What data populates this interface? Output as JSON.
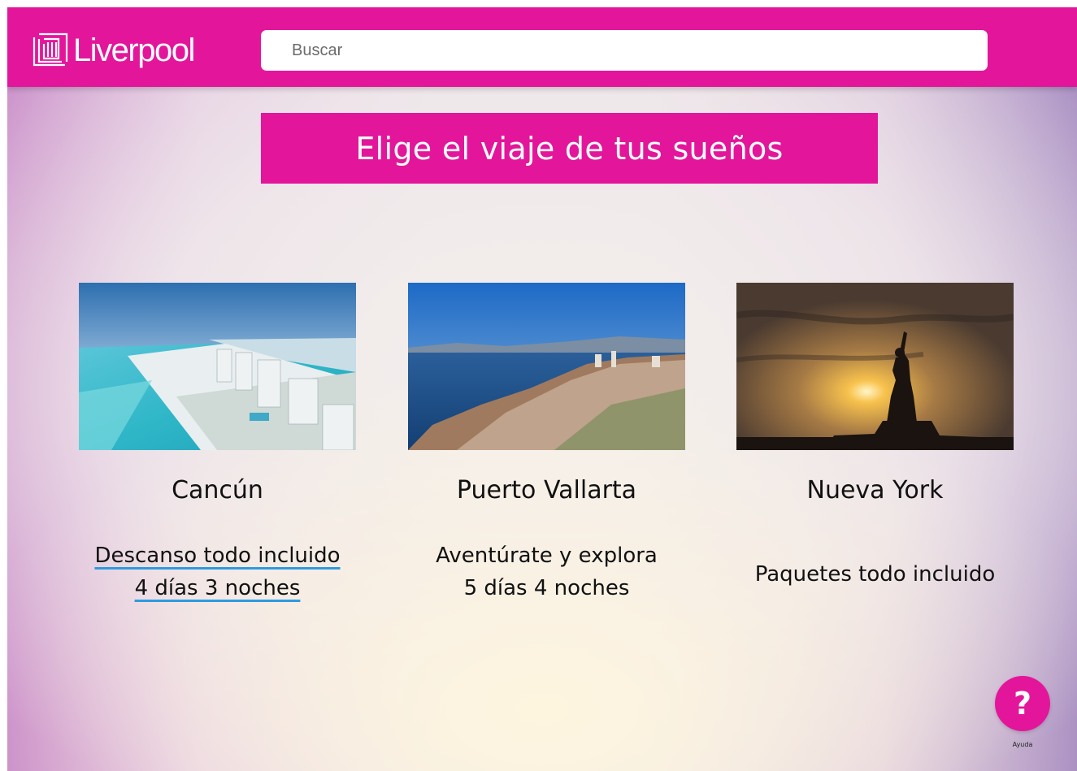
{
  "header": {
    "logo_text": "Liverpool",
    "search_placeholder": "Buscar"
  },
  "banner": {
    "title": "Elige el viaje de tus sueños"
  },
  "destinations": [
    {
      "name": "Cancún",
      "lines": [
        "Descanso todo incluido",
        "4 días 3 noches"
      ]
    },
    {
      "name": "Puerto Vallarta",
      "lines": [
        "Aventúrate y explora",
        "5 días 4 noches"
      ]
    },
    {
      "name": "Nueva York",
      "lines": [
        "Paquetes todo incluido"
      ]
    }
  ],
  "help": {
    "icon": "?",
    "label": "Ayuda"
  },
  "colors": {
    "brand": "#e3169b",
    "link_underline": "#2f9ae0"
  }
}
